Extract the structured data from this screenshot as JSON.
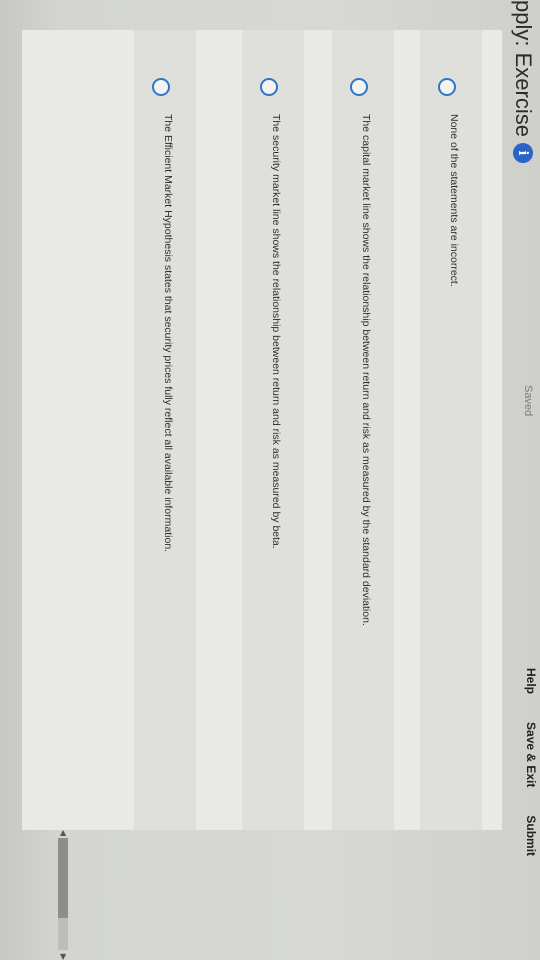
{
  "header": {
    "title": "pply: Exercise",
    "info_badge": "i",
    "saved": "Saved",
    "actions": {
      "help": "Help",
      "save_exit": "Save & Exit",
      "submit": "Submit"
    }
  },
  "options": [
    {
      "text": "None of the statements are incorrect."
    },
    {
      "text": "The capital market line shows the relationship between return and risk as measured by the standard deviation."
    },
    {
      "text": "The security market line shows the relationship between return and risk as measured by beta."
    },
    {
      "text": "The Efficient Market Hypothesis states that security prices fully reflect all available information."
    }
  ],
  "colors": {
    "radio_border": "#2f76c8",
    "info_badge": "#2a63c9"
  }
}
